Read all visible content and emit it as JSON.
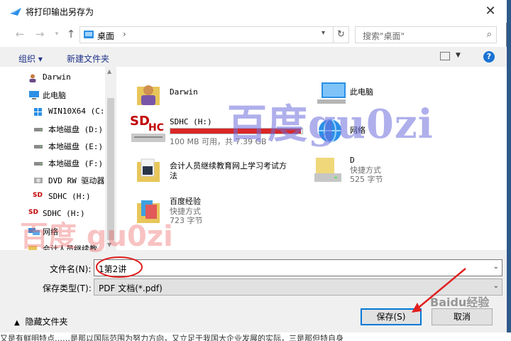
{
  "title": "将打印输出另存为",
  "address": {
    "path": "桌面",
    "search_placeholder": "搜索\"桌面\""
  },
  "toolbar": {
    "organize": "组织 ▾",
    "new_folder": "新建文件夹"
  },
  "sidebar": [
    {
      "label": "Darwin",
      "icon": "user-icon"
    },
    {
      "label": "此电脑",
      "icon": "computer-icon"
    },
    {
      "label": "WIN10X64 (C:)",
      "icon": "windows-drive-icon"
    },
    {
      "label": "本地磁盘 (D:)",
      "icon": "drive-icon"
    },
    {
      "label": "本地磁盘 (E:)",
      "icon": "drive-icon"
    },
    {
      "label": "本地磁盘 (F:)",
      "icon": "drive-icon"
    },
    {
      "label": "DVD RW 驱动器",
      "icon": "dvd-icon"
    },
    {
      "label": "SDHC (H:)",
      "icon": "sdhc-icon"
    },
    {
      "label": "SDHC (H:)",
      "icon": "sdhc-icon"
    },
    {
      "label": "网络",
      "icon": "network-icon"
    },
    {
      "label": "会计人员继续教",
      "icon": "folder-icon"
    }
  ],
  "items": [
    {
      "name": "Darwin",
      "sub": "",
      "icon": "user-folder-icon"
    },
    {
      "name": "此电脑",
      "sub": "",
      "icon": "computer-icon"
    },
    {
      "name": "SDHC (H:)",
      "sub": "100 MB 可用，共 7.39 GB",
      "icon": "sdhc-drive-icon",
      "used_fraction": 0.987
    },
    {
      "name": "网络",
      "sub": "",
      "icon": "network-icon"
    },
    {
      "name": "会计人员继续教育网上学习考试方",
      "name2": "法",
      "sub": "",
      "icon": "folder-icon"
    },
    {
      "name": "D",
      "sub": "快捷方式",
      "sub2": "525 字节",
      "icon": "shortcut-drive-icon"
    },
    {
      "name": "百度经验",
      "sub": "快捷方式",
      "sub2": "723 字节",
      "icon": "folder-shortcut-icon"
    }
  ],
  "filename": {
    "label": "文件名(N):",
    "value": "1第2讲"
  },
  "filetype": {
    "label": "保存类型(T):",
    "value": "PDF 文档(*.pdf)"
  },
  "hide_folders": "隐藏文件夹",
  "buttons": {
    "save": "保存(S)",
    "cancel": "取消"
  },
  "watermarks": {
    "main": "百度gu0zi",
    "red": "百度 gu0zi",
    "logo_text": "Baidu经验"
  },
  "background_text": "又是有鲜明特点……是那以国际范围为努力方向，又立足于我国大企业发展的实际，三是那但特自身",
  "accent": "#0078d7",
  "annotation_color": "#e02020"
}
